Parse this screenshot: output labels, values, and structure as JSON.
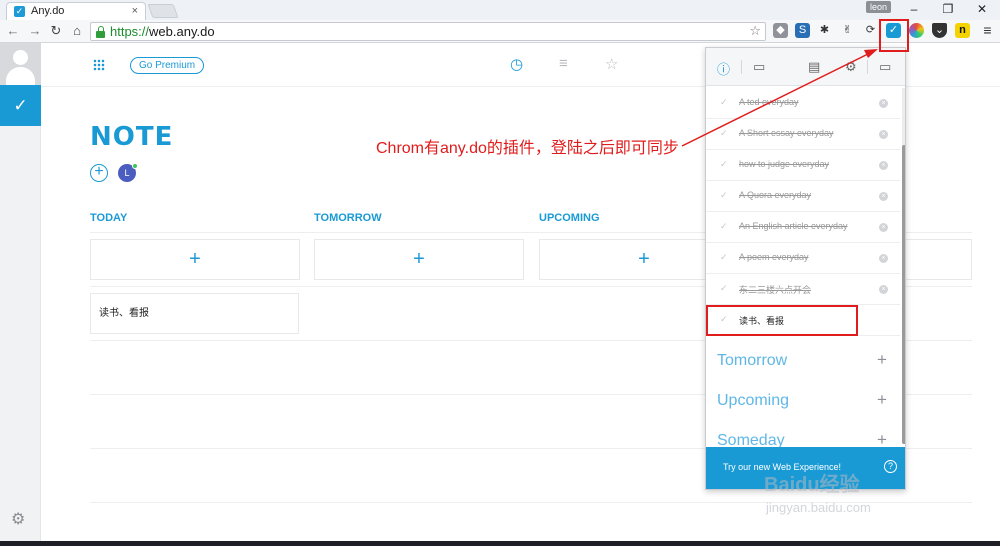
{
  "browser": {
    "tab_title": "Any.do",
    "user_badge": "leon",
    "url_scheme": "https://",
    "url_host": "web.any.do",
    "extensions": [
      "puzzle-icon",
      "s-icon",
      "bug-icon",
      "hand-icon",
      "refresh-icon",
      "anydo-icon",
      "photos-icon",
      "pocket-icon",
      "n-icon",
      "menu-icon"
    ]
  },
  "app": {
    "go_premium": "Go Premium",
    "list_title": "NOTE",
    "member_initial": "L",
    "columns": [
      "TODAY",
      "TOMORROW",
      "UPCOMING"
    ],
    "add_symbol": "+",
    "today_task": "读书、看报"
  },
  "annotation": {
    "text": "Chrom有any.do的插件，登陆之后即可同步"
  },
  "popup": {
    "tasks": [
      {
        "text": "A ted everyday",
        "done": true
      },
      {
        "text": "A Short essay everyday",
        "done": true
      },
      {
        "text": "how to judge everyday",
        "done": true
      },
      {
        "text": "A Quora everyday",
        "done": true
      },
      {
        "text": "An English article everyday",
        "done": true
      },
      {
        "text": "A poem everyday",
        "done": true
      },
      {
        "text": "东二三楼六点开会",
        "done": true
      },
      {
        "text": "读书、看报",
        "done": false
      }
    ],
    "sections": [
      "Tomorrow",
      "Upcoming",
      "Someday"
    ],
    "footer": "Try our new Web Experience!"
  },
  "watermark": {
    "main": "Baidu经验",
    "sub": "jingyan.baidu.com"
  },
  "colors": {
    "accent": "#1a9ad4",
    "annotation": "#e01c1c"
  }
}
